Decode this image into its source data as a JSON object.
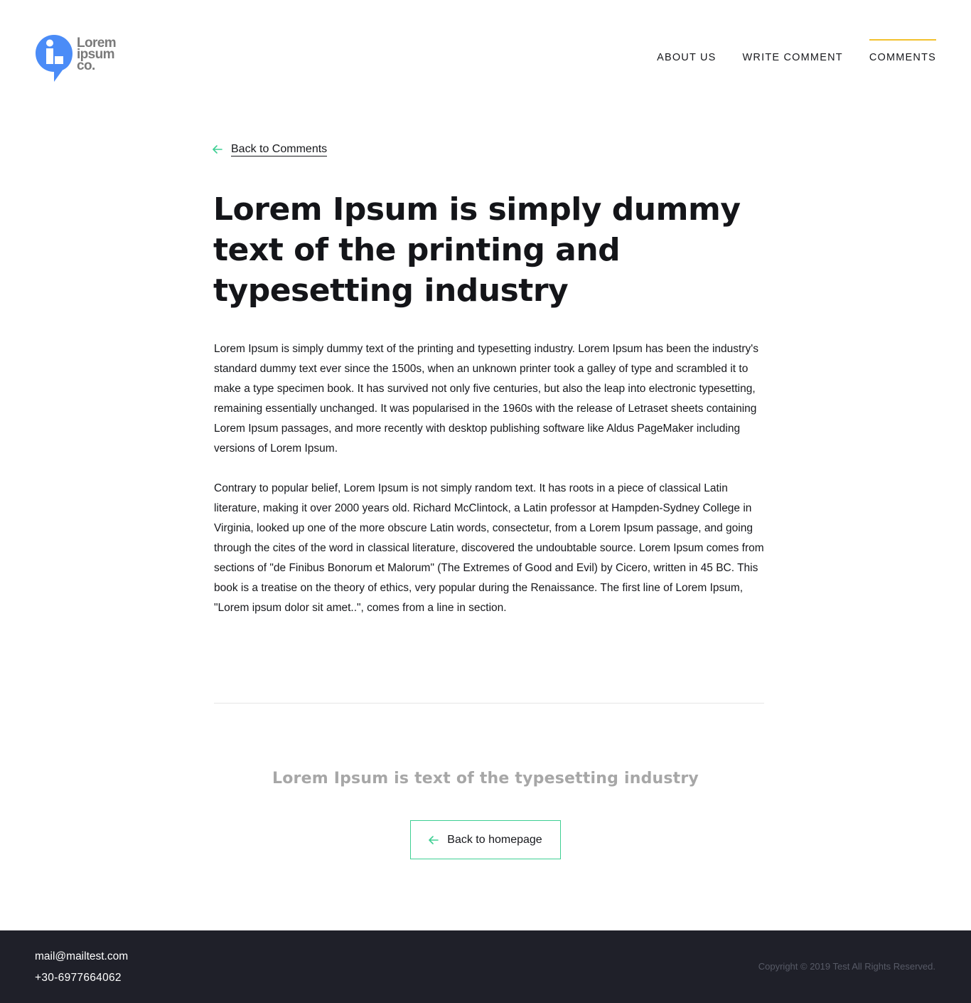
{
  "brand": {
    "logo_lines": [
      "Lorem",
      "ipsum",
      "co."
    ],
    "logo_color": "#4b8cf7",
    "logo_icon": "info-bubble-icon"
  },
  "nav": {
    "items": [
      {
        "label": "ABOUT US",
        "active": false
      },
      {
        "label": "WRITE COMMENT",
        "active": false
      },
      {
        "label": "COMMENTS",
        "active": true
      }
    ],
    "active_indicator_color": "#f2c12e"
  },
  "back_link": {
    "label": "Back to Comments",
    "icon": "arrow-left-icon",
    "icon_color": "#3ecf93"
  },
  "article": {
    "title": "Lorem Ipsum is simply dummy text of the printing and typesetting industry",
    "paragraphs": [
      "Lorem Ipsum is simply dummy text of the printing and typesetting industry. Lorem Ipsum has been the industry's standard dummy text ever since the 1500s, when an unknown printer took a galley of type and scrambled it to make a type specimen book. It has survived not only five centuries, but also the leap into electronic typesetting, remaining essentially unchanged. It was popularised in the 1960s with the release of Letraset sheets containing Lorem Ipsum passages, and more recently with desktop publishing software like Aldus PageMaker including versions of Lorem Ipsum.",
      "Contrary to popular belief, Lorem Ipsum is not simply random text. It has roots in a piece of classical Latin literature, making it over 2000 years old. Richard McClintock, a Latin professor at Hampden-Sydney College in Virginia, looked up one of the more obscure Latin words, consectetur, from a Lorem Ipsum passage, and going through the cites of the word in classical literature, discovered the undoubtable source. Lorem Ipsum comes from sections of \"de Finibus Bonorum et Malorum\" (The Extremes of Good and Evil) by Cicero, written in 45 BC. This book is a treatise on the theory of ethics, very popular during the Renaissance. The first line of Lorem Ipsum, \"Lorem ipsum dolor sit amet..\", comes from a line in section."
    ]
  },
  "cta": {
    "tagline": "Lorem Ipsum is text of the typesetting industry",
    "button_label": "Back to homepage",
    "button_border_color": "#3ecf93"
  },
  "footer": {
    "email": "mail@mailtest.com",
    "phone": "+30-6977664062",
    "copyright": "Copyright © 2019 Test All Rights Reserved.",
    "background": "#1f2029"
  }
}
